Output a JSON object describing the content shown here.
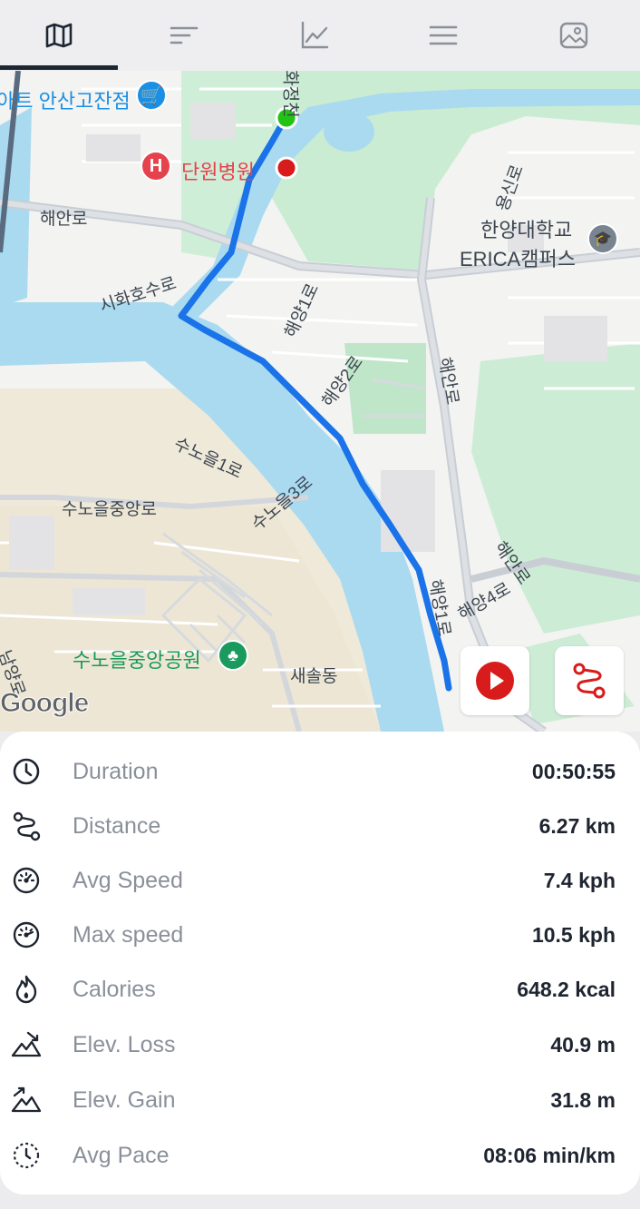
{
  "tabs": [
    {
      "name": "map-icon",
      "active": true
    },
    {
      "name": "sort-icon",
      "active": false
    },
    {
      "name": "chart-icon",
      "active": false
    },
    {
      "name": "menu-icon",
      "active": false
    },
    {
      "name": "photo-icon",
      "active": false
    }
  ],
  "map": {
    "labels": {
      "mart": "아트 안산고잔점",
      "hospital": "단원병원",
      "haean_ro_1": "해안로",
      "sihwaho_suro": "시화호수로",
      "university_1": "한양대학교",
      "university_2": "ERICA캠퍼스",
      "hwajeong": "화정천",
      "yongsin_ro": "용신로",
      "haeyang_1ro_a": "해양1로",
      "haeyang_2ro": "해양2로",
      "haean_ro_2": "해안로",
      "haean_ro_3": "해안로",
      "sunoeul_1ro": "수노을1로",
      "sunoeul_3ro": "수노을3로",
      "sunoeul_jungang_ro": "수노을중앙로",
      "haeyang_4ro": "해양4로",
      "haeyang_1ro_b": "해양1로",
      "park": "수노을중앙공원",
      "saesol": "새솔동",
      "namyang": "남양로",
      "google": "Google"
    },
    "poi_colors": {
      "mart": "#1a8fe3",
      "hospital": "#e5424d",
      "park": "#1a9a5c",
      "university": "#78848f"
    },
    "route_color": "#1a73e8",
    "start_color": "#22c314",
    "end_color": "#d81b1b",
    "play_button": "play-icon",
    "route_button": "route-icon"
  },
  "stats": [
    {
      "icon": "clock-icon",
      "label": "Duration",
      "value": "00:50:55"
    },
    {
      "icon": "route-icon",
      "label": "Distance",
      "value": "6.27 km"
    },
    {
      "icon": "speedometer-icon",
      "label": "Avg Speed",
      "value": "7.4 kph"
    },
    {
      "icon": "max-speed-icon",
      "label": "Max speed",
      "value": "10.5 kph"
    },
    {
      "icon": "flame-icon",
      "label": "Calories",
      "value": "648.2 kcal"
    },
    {
      "icon": "elevation-loss-icon",
      "label": "Elev. Loss",
      "value": "40.9 m"
    },
    {
      "icon": "elevation-gain-icon",
      "label": "Elev. Gain",
      "value": "31.8 m"
    },
    {
      "icon": "pace-icon",
      "label": "Avg Pace",
      "value": "08:06 min/km"
    }
  ]
}
